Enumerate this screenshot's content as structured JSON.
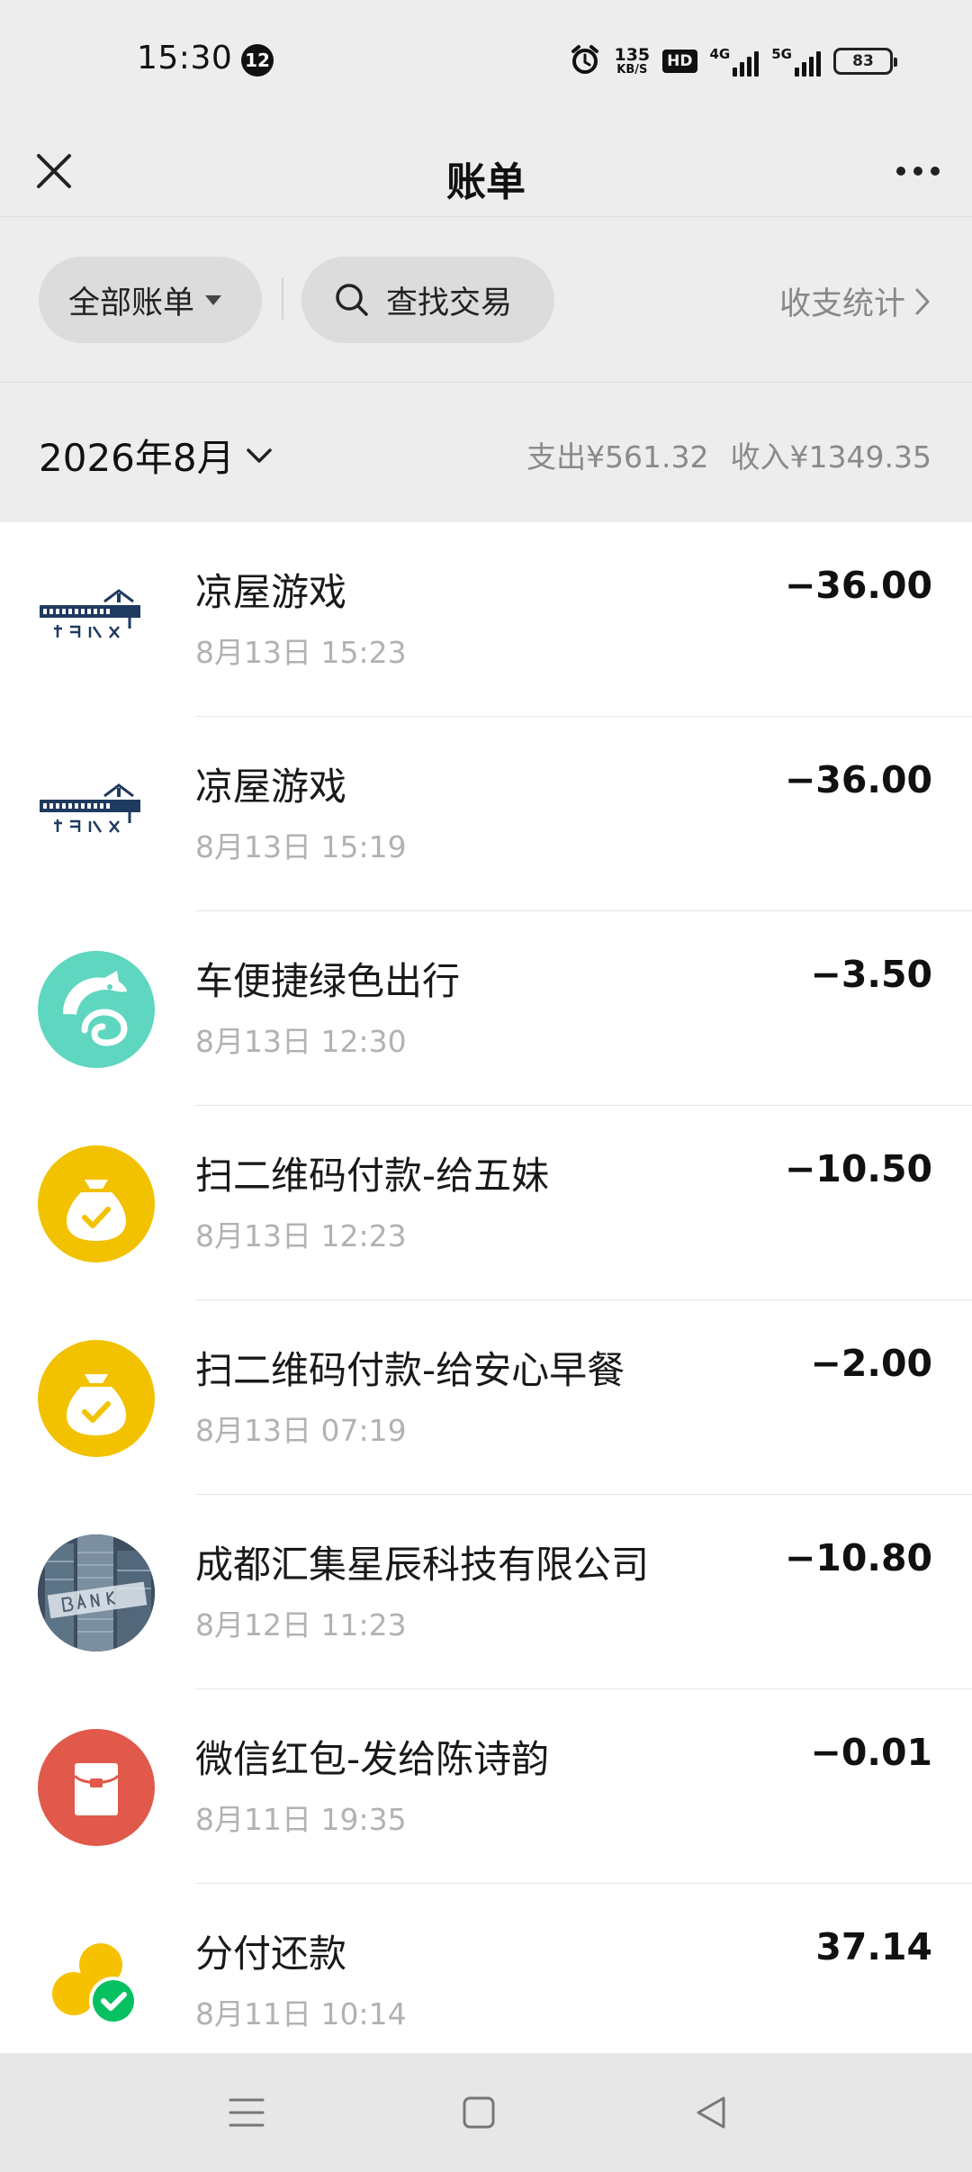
{
  "status_bar": {
    "time": "15:30",
    "notification_count": "12",
    "net_speed_value": "135",
    "net_speed_unit": "KB/S",
    "hd_label": "HD",
    "network_1": "4G",
    "network_2": "5G",
    "battery": "83"
  },
  "header": {
    "title": "账单"
  },
  "filters": {
    "all_bills": "全部账单",
    "search": "查找交易",
    "stats": "收支统计"
  },
  "month": {
    "label": "2026年8月",
    "expense": "支出¥561.32",
    "income": "收入¥1349.35"
  },
  "transactions": [
    {
      "title": "凉屋游戏",
      "time": "8月13日 15:23",
      "amount": "−36.00",
      "icon": "chillyroom-logo-icon"
    },
    {
      "title": "凉屋游戏",
      "time": "8月13日 15:19",
      "amount": "−36.00",
      "icon": "chillyroom-logo-icon"
    },
    {
      "title": "车便捷绿色出行",
      "time": "8月13日 12:30",
      "amount": "−3.50",
      "icon": "dolphin-logo-icon"
    },
    {
      "title": "扫二维码付款-给五妹",
      "time": "8月13日 12:23",
      "amount": "−10.50",
      "icon": "money-bag-icon"
    },
    {
      "title": "扫二维码付款-给安心早餐",
      "time": "8月13日 07:19",
      "amount": "−2.00",
      "icon": "money-bag-icon"
    },
    {
      "title": "成都汇集星辰科技有限公司",
      "time": "8月12日 11:23",
      "amount": "−10.80",
      "icon": "bank-photo-icon"
    },
    {
      "title": "微信红包-发给陈诗韵",
      "time": "8月11日 19:35",
      "amount": "−0.01",
      "icon": "red-packet-icon"
    },
    {
      "title": "分付还款",
      "time": "8月11日 10:14",
      "amount": "37.14",
      "icon": "fenfu-repay-icon"
    }
  ],
  "colors": {
    "page_bg": "#ededed",
    "list_bg": "#ffffff",
    "dolphin_teal": "#5fd6bf",
    "money_yellow": "#f2c200",
    "red_packet": "#e0594a",
    "wechat_green": "#07c160",
    "muted_text": "#b2b2b2"
  },
  "nav_buttons": [
    "menu-icon",
    "home-icon",
    "back-icon"
  ]
}
